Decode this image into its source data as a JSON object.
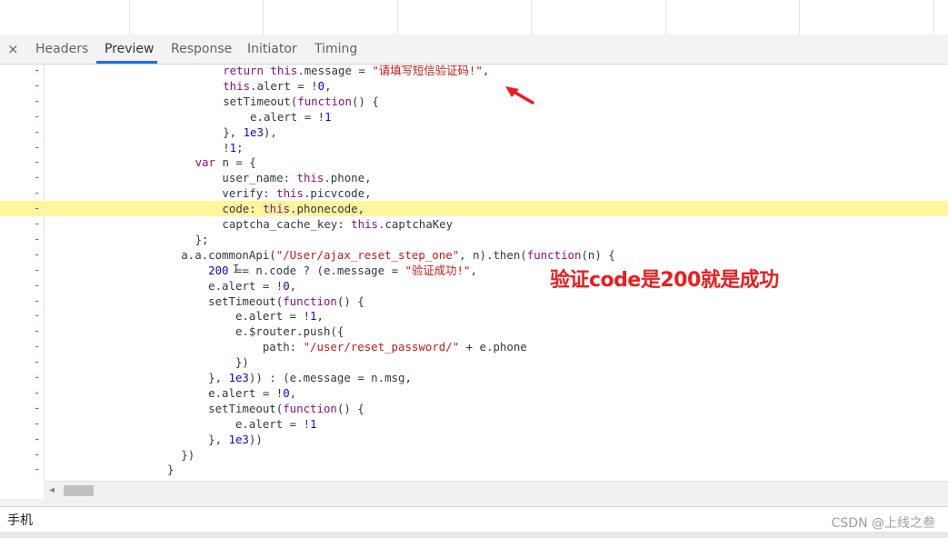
{
  "tabs": {
    "close": "×",
    "items": [
      "Headers",
      "Preview",
      "Response",
      "Initiator",
      "Timing"
    ],
    "active": "Preview"
  },
  "code_lines": [
    {
      "segs": [
        [
          "kw",
          "return "
        ],
        [
          "kw",
          "this"
        ],
        [
          "",
          "."
        ],
        [
          "",
          "message = "
        ],
        [
          "str",
          "\"请填写短信验证码!\""
        ],
        [
          "",
          ","
        ]
      ]
    },
    {
      "segs": [
        [
          "kw",
          "this"
        ],
        [
          "",
          ".alert = !"
        ],
        [
          "num",
          "0"
        ],
        [
          "",
          ","
        ]
      ]
    },
    {
      "segs": [
        [
          "",
          "setTimeout("
        ],
        [
          "kw",
          "function"
        ],
        [
          "",
          "() {"
        ]
      ]
    },
    {
      "segs": [
        [
          "",
          "    e.alert = !"
        ],
        [
          "num",
          "1"
        ]
      ]
    },
    {
      "segs": [
        [
          "",
          "}, "
        ],
        [
          "num",
          "1e3"
        ],
        [
          "",
          "),"
        ]
      ]
    },
    {
      "segs": [
        [
          "",
          "!"
        ],
        [
          "num",
          "1"
        ],
        [
          "",
          ";"
        ]
      ]
    },
    {
      "segs": [
        [
          "kw",
          "var "
        ],
        [
          "",
          "n = {"
        ]
      ]
    },
    {
      "segs": [
        [
          "",
          "    user_name: "
        ],
        [
          "kw",
          "this"
        ],
        [
          "",
          ".phone,"
        ]
      ]
    },
    {
      "segs": [
        [
          "",
          "    verify: "
        ],
        [
          "kw",
          "this"
        ],
        [
          "",
          ".picvcode,"
        ]
      ]
    },
    {
      "segs": [
        [
          "",
          "    code: "
        ],
        [
          "kw",
          "this"
        ],
        [
          "",
          ".phonecode,"
        ]
      ]
    },
    {
      "segs": [
        [
          "",
          "    captcha_cache_key: "
        ],
        [
          "kw",
          "this"
        ],
        [
          "",
          ".captchaKey"
        ]
      ]
    },
    {
      "segs": [
        [
          "",
          "};"
        ]
      ]
    },
    {
      "segs": [
        [
          "",
          "a.a.commonApi("
        ],
        [
          "str",
          "\"/User/ajax_reset_step_one\""
        ],
        [
          "",
          ", n).then("
        ],
        [
          "kw",
          "function"
        ],
        [
          "",
          "(n) {"
        ]
      ]
    },
    {
      "segs": [
        [
          "",
          "    "
        ],
        [
          "num",
          "200"
        ],
        [
          "",
          " == n.code ? (e.message = "
        ],
        [
          "str",
          "\"验证成功!\""
        ],
        [
          "",
          ","
        ]
      ]
    },
    {
      "segs": [
        [
          "",
          "    e.alert = !"
        ],
        [
          "num",
          "0"
        ],
        [
          "",
          ","
        ]
      ]
    },
    {
      "segs": [
        [
          "",
          "    setTimeout("
        ],
        [
          "kw",
          "function"
        ],
        [
          "",
          "() {"
        ]
      ]
    },
    {
      "segs": [
        [
          "",
          "        e.alert = !"
        ],
        [
          "num",
          "1"
        ],
        [
          "",
          ","
        ]
      ]
    },
    {
      "segs": [
        [
          "",
          "        e.$router.push({"
        ]
      ]
    },
    {
      "segs": [
        [
          "",
          "            path: "
        ],
        [
          "str",
          "\"/user/reset_password/\""
        ],
        [
          "",
          " + e.phone"
        ]
      ]
    },
    {
      "segs": [
        [
          "",
          "        })"
        ]
      ]
    },
    {
      "segs": [
        [
          "",
          "    }, "
        ],
        [
          "num",
          "1e3"
        ],
        [
          "",
          ")) : (e.message = n.msg,"
        ]
      ]
    },
    {
      "segs": [
        [
          "",
          "    e.alert = !"
        ],
        [
          "num",
          "0"
        ],
        [
          "",
          ","
        ]
      ]
    },
    {
      "segs": [
        [
          "",
          "    setTimeout("
        ],
        [
          "kw",
          "function"
        ],
        [
          "",
          "() {"
        ]
      ]
    },
    {
      "segs": [
        [
          "",
          "        e.alert = !"
        ],
        [
          "num",
          "1"
        ]
      ]
    },
    {
      "segs": [
        [
          "",
          "    }, "
        ],
        [
          "num",
          "1e3"
        ],
        [
          "",
          "))"
        ]
      ]
    },
    {
      "segs": [
        [
          "",
          "})"
        ]
      ]
    },
    {
      "segs": [
        [
          "",
          "}"
        ]
      ]
    }
  ],
  "highlight_line": 9,
  "annotation": "验证code是200就是成功",
  "search": {
    "value": "手机"
  },
  "watermark": "CSDN @上线之叁",
  "colors": {
    "accent": "#1a73e8",
    "highlight": "#fff59d",
    "annotation": "#ee1c1c"
  }
}
